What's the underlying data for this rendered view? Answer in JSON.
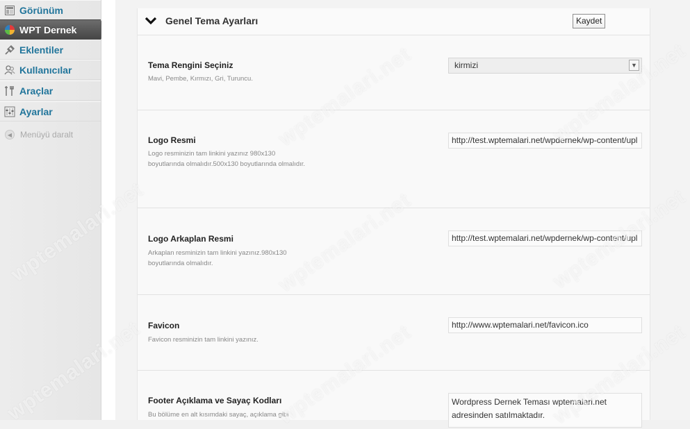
{
  "sidebar": {
    "items": [
      {
        "label": "Görünüm",
        "icon": "appearance-icon"
      },
      {
        "label": "WPT Dernek",
        "icon": "plugin-color-icon",
        "active": true
      },
      {
        "label": "Eklentiler",
        "icon": "plugins-icon"
      },
      {
        "label": "Kullanıcılar",
        "icon": "users-icon"
      },
      {
        "label": "Araçlar",
        "icon": "tools-icon"
      },
      {
        "label": "Ayarlar",
        "icon": "settings-icon"
      }
    ],
    "collapse_label": "Menüyü daralt"
  },
  "panel": {
    "title": "Genel Tema Ayarları",
    "save_label": "Kaydet"
  },
  "fields": {
    "theme_color": {
      "label": "Tema Rengini Seçiniz",
      "description": "Mavi, Pembe, Kırmızı, Gri, Turuncu.",
      "value": "kirmizi"
    },
    "logo": {
      "label": "Logo Resmi",
      "description": "Logo resminizin tam linkini yazınız 980x130 boyutlarında olmalıdır.500x130 boyutlarında olmalıdır.",
      "value": "http://test.wptemalari.net/wpdernek/wp-content/upl"
    },
    "logo_bg": {
      "label": "Logo Arkaplan Resmi",
      "description": "Arkaplan resminizin tam linkini yazınız.980x130 boyutlarında olmalıdır.",
      "value": "http://test.wptemalari.net/wpdernek/wp-content/upl"
    },
    "favicon": {
      "label": "Favicon",
      "description": "Favicon resminizin tam linkini yazınız.",
      "value": "http://www.wptemalari.net/favicon.ico"
    },
    "footer": {
      "label": "Footer Açıklama ve Sayaç Kodları",
      "description": "Bu bölüme en alt kısımdaki sayaç, açıklama gibi",
      "value": "Wordpress Dernek Teması wptemalari.net adresinden satılmaktadır."
    }
  },
  "watermark": "wptemalari.net",
  "colors": {
    "link": "#21759b",
    "active_menu": "#5a5a5a"
  }
}
